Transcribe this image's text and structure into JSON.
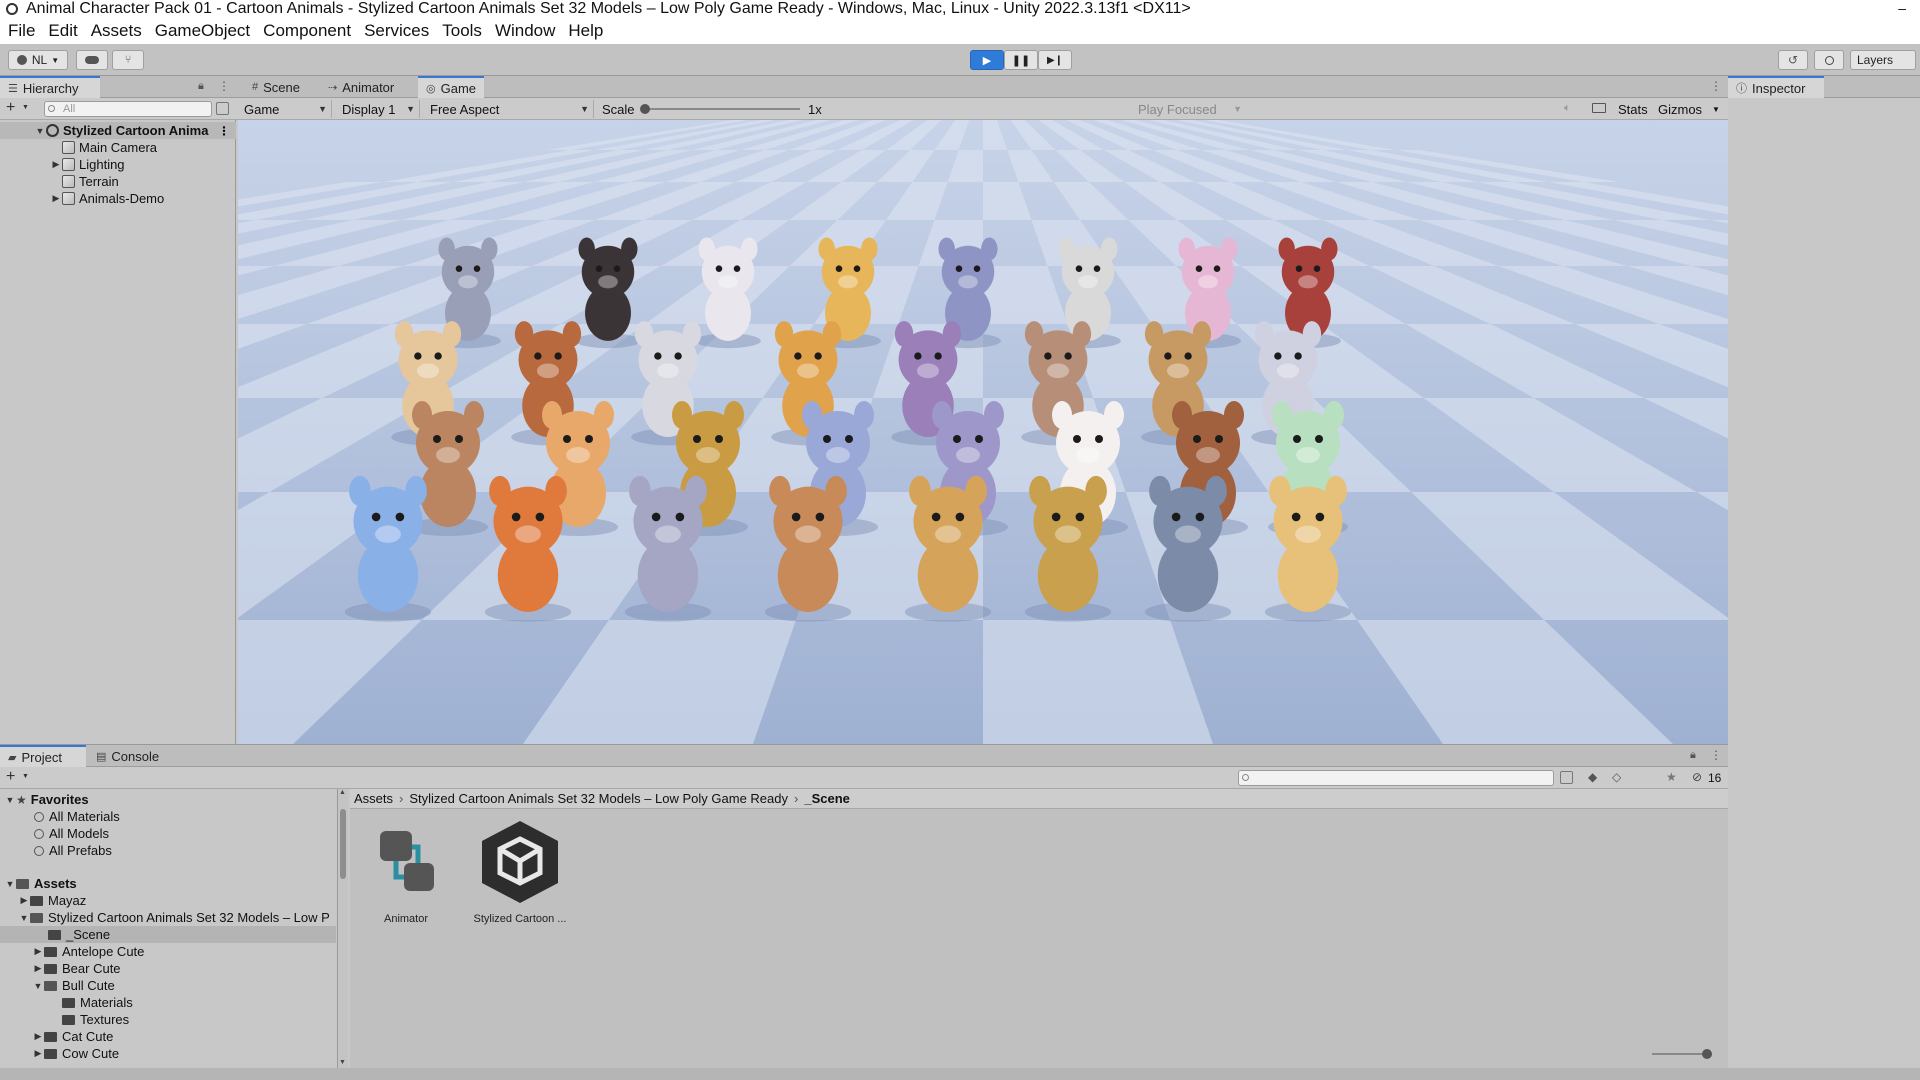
{
  "window": {
    "title": "Animal Character Pack 01 - Cartoon Animals - Stylized Cartoon Animals Set 32 Models – Low Poly Game Ready - Windows, Mac, Linux - Unity 2022.3.13f1 <DX11>",
    "minimize": "–"
  },
  "menu": [
    "File",
    "Edit",
    "Assets",
    "GameObject",
    "Component",
    "Services",
    "Tools",
    "Window",
    "Help"
  ],
  "toolbar": {
    "account": "NL",
    "layers": "Layers"
  },
  "hierarchy": {
    "tab": "Hierarchy",
    "search_placeholder": "All",
    "scene": "Stylized Cartoon Anima",
    "items": [
      "Main Camera",
      "Lighting",
      "Terrain",
      "Animals-Demo"
    ]
  },
  "center_tabs": [
    "Scene",
    "Animator",
    "Game"
  ],
  "game_bar": {
    "mode": "Game",
    "display": "Display 1",
    "aspect": "Free Aspect",
    "scale_label": "Scale",
    "scale_value": "1x",
    "play_focused": "Play Focused",
    "stats": "Stats",
    "gizmos": "Gizmos"
  },
  "inspector": {
    "tab": "Inspector"
  },
  "project": {
    "tabs": [
      "Project",
      "Console"
    ],
    "favorites": {
      "label": "Favorites",
      "items": [
        "All Materials",
        "All Models",
        "All Prefabs"
      ]
    },
    "assets_label": "Assets",
    "folders": [
      "Mayaz",
      "Stylized Cartoon Animals Set 32 Models – Low P",
      "_Scene",
      "Antelope Cute",
      "Bear Cute",
      "Bull Cute",
      "Materials",
      "Textures",
      "Cat Cute",
      "Cow Cute"
    ],
    "breadcrumb": [
      "Assets",
      "Stylized Cartoon Animals Set 32 Models – Low Poly Game Ready",
      "_Scene"
    ],
    "assets": [
      {
        "name": "Animator"
      },
      {
        "name": "Stylized Cartoon ..."
      }
    ],
    "hidden_count": "16"
  },
  "colors": {
    "accent": "#3a78d0",
    "play": "#2f7bd8",
    "panel": "#c8c8c8",
    "sky": "#a9bad8"
  }
}
